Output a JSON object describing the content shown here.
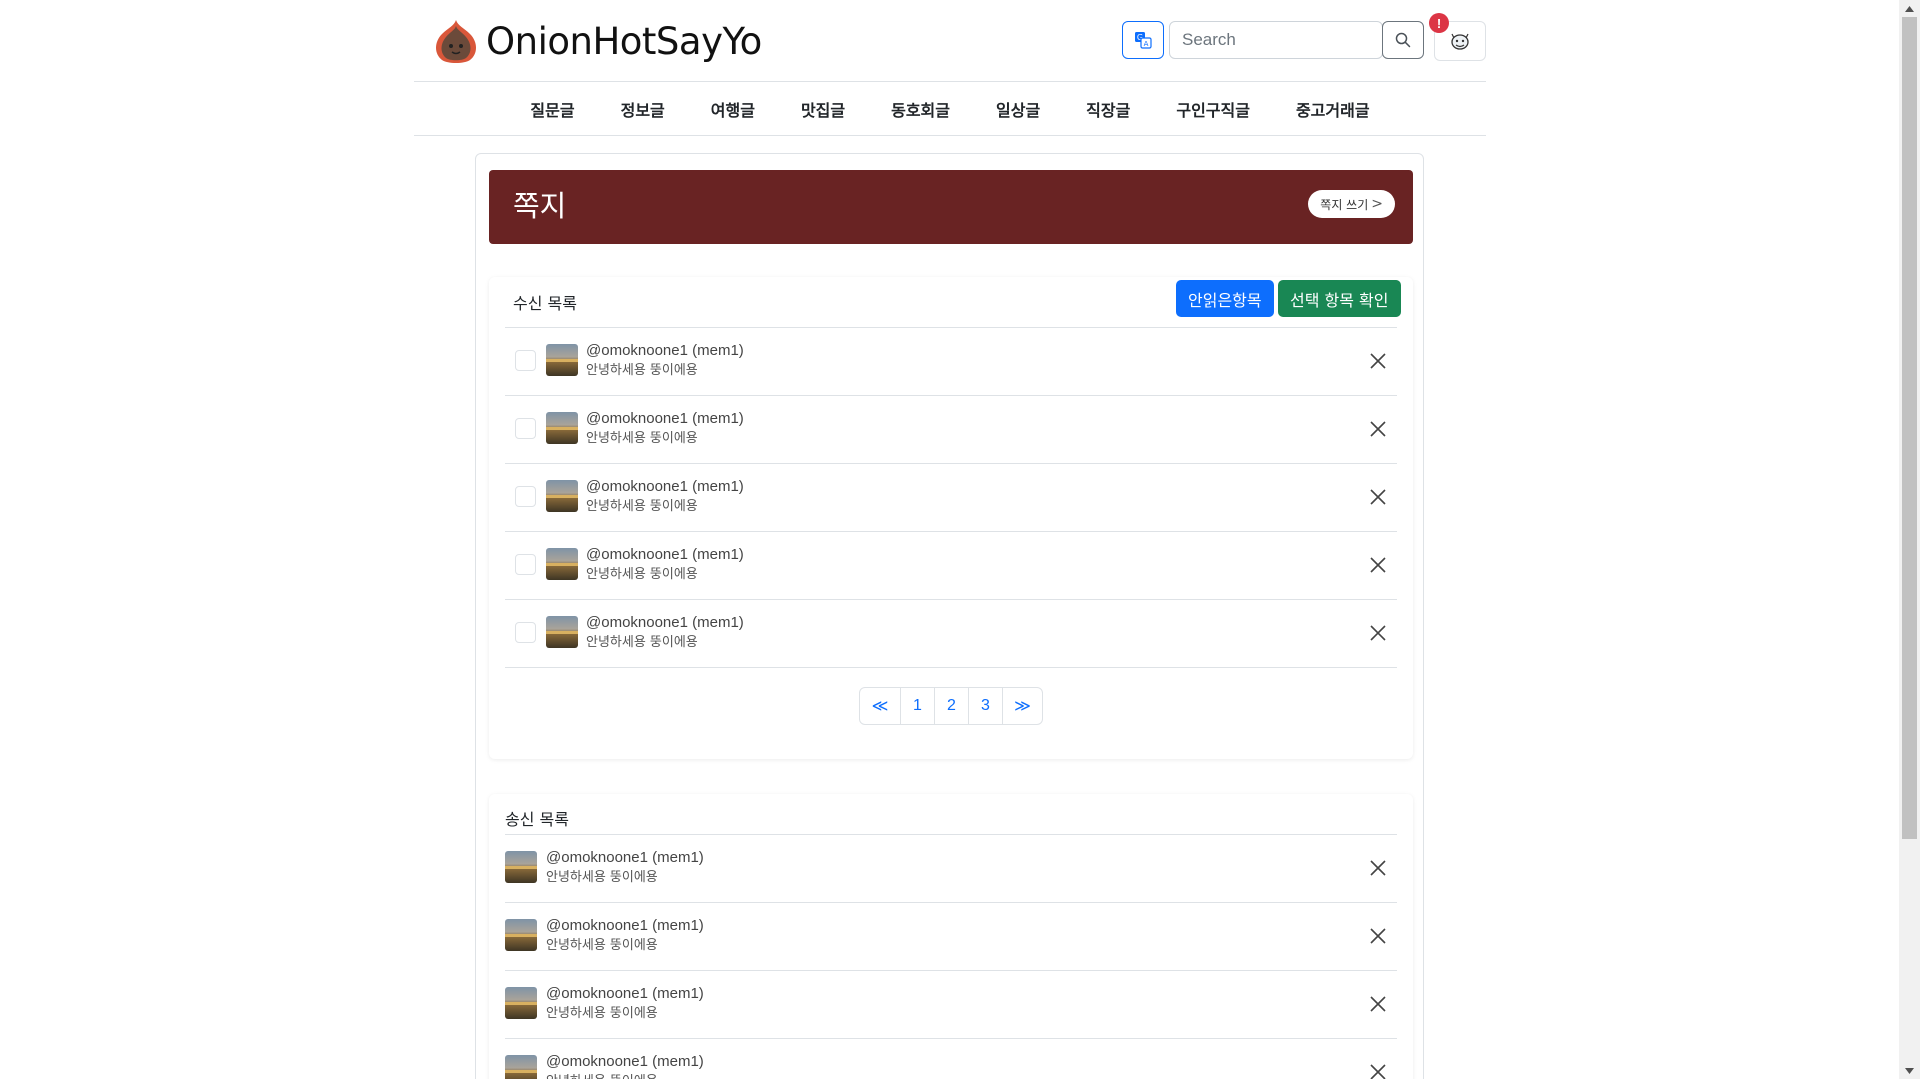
{
  "header": {
    "site_name": "OnionHotSayYo",
    "search_placeholder": "Search",
    "notification_badge": "!"
  },
  "nav": {
    "items": [
      "질문글",
      "정보글",
      "여행글",
      "맛집글",
      "동호회글",
      "일상글",
      "직장글",
      "구인구직글",
      "중고거래글"
    ]
  },
  "banner": {
    "title": "쪽지",
    "write_label": "쪽지 쓰기"
  },
  "received": {
    "title": "수신 목록",
    "unread_button": "안읽은항목",
    "confirm_button": "선택 항목 확인",
    "messages": [
      {
        "name": "@omoknoone1 (mem1)",
        "preview": "안녕하세용 뚱이에용"
      },
      {
        "name": "@omoknoone1 (mem1)",
        "preview": "안녕하세용 뚱이에용"
      },
      {
        "name": "@omoknoone1 (mem1)",
        "preview": "안녕하세용 뚱이에용"
      },
      {
        "name": "@omoknoone1 (mem1)",
        "preview": "안녕하세용 뚱이에용"
      },
      {
        "name": "@omoknoone1 (mem1)",
        "preview": "안녕하세용 뚱이에용"
      }
    ],
    "pagination": {
      "prev": "≪",
      "pages": [
        "1",
        "2",
        "3"
      ],
      "next": "≫"
    }
  },
  "sent": {
    "title": "송신 목록",
    "messages": [
      {
        "name": "@omoknoone1 (mem1)",
        "preview": "안녕하세용 뚱이에용"
      },
      {
        "name": "@omoknoone1 (mem1)",
        "preview": "안녕하세용 뚱이에용"
      },
      {
        "name": "@omoknoone1 (mem1)",
        "preview": "안녕하세용 뚱이에용"
      },
      {
        "name": "@omoknoone1 (mem1)",
        "preview": "안녕하세용 뚱이에용"
      }
    ]
  },
  "colors": {
    "banner_bg": "#692323",
    "primary": "#0d6efd",
    "success": "#198754",
    "danger": "#dc3545"
  }
}
